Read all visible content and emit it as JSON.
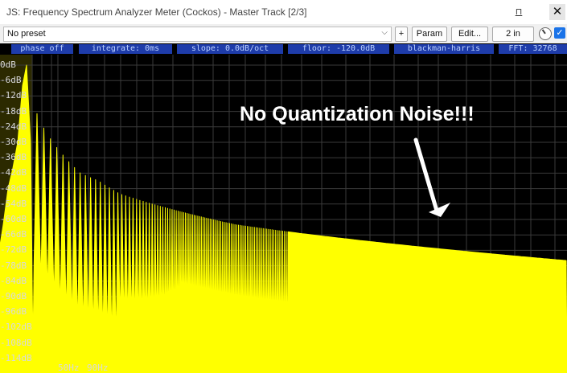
{
  "window": {
    "title": "JS: Frequency Spectrum Analyzer Meter (Cockos) - Master Track [2/3]",
    "pin_label": "⊓",
    "close_label": "✕"
  },
  "toolbar": {
    "preset_value": "No preset",
    "add_label": "+",
    "param_label": "Param",
    "edit_label": "Edit...",
    "io_label": "2 in",
    "enabled_label": "✓"
  },
  "status_bar": [
    "phase off",
    "integrate: 0ms",
    "slope: 0.0dB/oct",
    "floor: -120.0dB",
    "blackman-harris",
    "FFT: 32768"
  ],
  "annotation": {
    "text": "No Quantization Noise!!!",
    "color": "#ffffff"
  },
  "colors": {
    "spectrum": "#ffff00",
    "background": "#000000",
    "grid": "#3a3a3a",
    "status_chip": "#1e3caa"
  },
  "chart_data": {
    "type": "area",
    "y_labels": [
      "0dB",
      "-6dB",
      "-12dB",
      "-18dB",
      "-24dB",
      "-30dB",
      "-36dB",
      "-42dB",
      "-48dB",
      "-54dB",
      "-60dB",
      "-66dB",
      "-72dB",
      "-78dB",
      "-84dB",
      "-90dB",
      "-96dB",
      "-102dB",
      "-108dB",
      "-114dB"
    ],
    "x_labels": [
      "50Hz",
      "90Hz"
    ],
    "ylim": [
      -120,
      0
    ],
    "grid": true,
    "y_scale": "dB",
    "x_scale": "log",
    "series": [
      {
        "peaks_envelope_db": [
          0,
          -6,
          -12,
          -18,
          -24,
          -30,
          -36,
          -42,
          -45,
          -50,
          -53,
          -56,
          -59,
          -62,
          -64,
          -66,
          -68,
          -70,
          -72,
          -74,
          -76
        ],
        "final_level_db": -76
      }
    ]
  }
}
